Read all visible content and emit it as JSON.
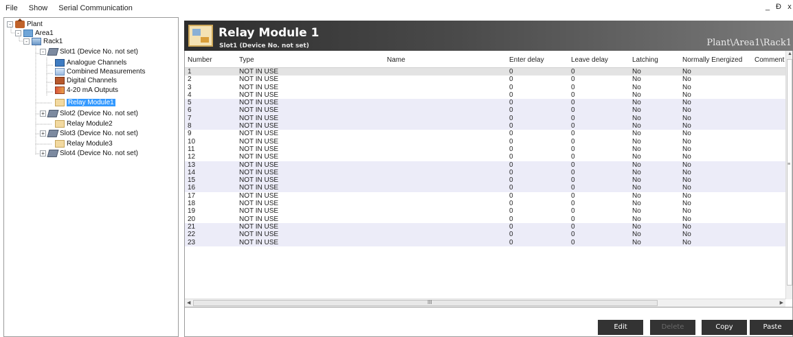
{
  "menu": {
    "items": [
      "File",
      "Show",
      "Serial Communication"
    ]
  },
  "window_controls": {
    "minimize": "_",
    "restore": "Ɖ",
    "close": "x"
  },
  "tree": {
    "nodes": [
      {
        "label": "Plant",
        "icon": "plant-icon",
        "expander": "-"
      },
      {
        "label": "Area1",
        "icon": "area-icon",
        "expander": "-"
      },
      {
        "label": "Rack1",
        "icon": "rack-icon",
        "expander": "-"
      },
      {
        "label": "Slot1 (Device No. not set)",
        "icon": "slot-icon",
        "expander": "-"
      },
      {
        "label": "Analogue Channels",
        "icon": "analogue-channels-icon"
      },
      {
        "label": "Combined Measurements",
        "icon": "combined-measurements-icon"
      },
      {
        "label": "Digital Channels",
        "icon": "digital-channels-icon"
      },
      {
        "label": "4-20 mA Outputs",
        "icon": "outputs-icon"
      },
      {
        "label": "Relay Module1",
        "icon": "relay-module-icon",
        "selected": true
      },
      {
        "label": "Slot2 (Device No. not set)",
        "icon": "slot-icon",
        "expander": "+"
      },
      {
        "label": "Relay Module2",
        "icon": "relay-module-icon"
      },
      {
        "label": "Slot3 (Device No. not set)",
        "icon": "slot-icon",
        "expander": "+"
      },
      {
        "label": "Relay Module3",
        "icon": "relay-module-icon"
      },
      {
        "label": "Slot4 (Device No. not set)",
        "icon": "slot-icon",
        "expander": "+"
      }
    ]
  },
  "header": {
    "title": "Relay Module 1",
    "subtitle": "Slot1 (Device No. not set)",
    "path": "Plant\\Area1\\Rack1"
  },
  "table": {
    "columns": [
      "Number",
      "Type",
      "Name",
      "Enter delay",
      "Leave delay",
      "Latching",
      "Normally Energized",
      "Comment"
    ],
    "rows": [
      [
        "1",
        "NOT IN USE",
        "",
        "0",
        "0",
        "No",
        "No",
        ""
      ],
      [
        "2",
        "NOT IN USE",
        "",
        "0",
        "0",
        "No",
        "No",
        ""
      ],
      [
        "3",
        "NOT IN USE",
        "",
        "0",
        "0",
        "No",
        "No",
        ""
      ],
      [
        "4",
        "NOT IN USE",
        "",
        "0",
        "0",
        "No",
        "No",
        ""
      ],
      [
        "5",
        "NOT IN USE",
        "",
        "0",
        "0",
        "No",
        "No",
        ""
      ],
      [
        "6",
        "NOT IN USE",
        "",
        "0",
        "0",
        "No",
        "No",
        ""
      ],
      [
        "7",
        "NOT IN USE",
        "",
        "0",
        "0",
        "No",
        "No",
        ""
      ],
      [
        "8",
        "NOT IN USE",
        "",
        "0",
        "0",
        "No",
        "No",
        ""
      ],
      [
        "9",
        "NOT IN USE",
        "",
        "0",
        "0",
        "No",
        "No",
        ""
      ],
      [
        "10",
        "NOT IN USE",
        "",
        "0",
        "0",
        "No",
        "No",
        ""
      ],
      [
        "11",
        "NOT IN USE",
        "",
        "0",
        "0",
        "No",
        "No",
        ""
      ],
      [
        "12",
        "NOT IN USE",
        "",
        "0",
        "0",
        "No",
        "No",
        ""
      ],
      [
        "13",
        "NOT IN USE",
        "",
        "0",
        "0",
        "No",
        "No",
        ""
      ],
      [
        "14",
        "NOT IN USE",
        "",
        "0",
        "0",
        "No",
        "No",
        ""
      ],
      [
        "15",
        "NOT IN USE",
        "",
        "0",
        "0",
        "No",
        "No",
        ""
      ],
      [
        "16",
        "NOT IN USE",
        "",
        "0",
        "0",
        "No",
        "No",
        ""
      ],
      [
        "17",
        "NOT IN USE",
        "",
        "0",
        "0",
        "No",
        "No",
        ""
      ],
      [
        "18",
        "NOT IN USE",
        "",
        "0",
        "0",
        "No",
        "No",
        ""
      ],
      [
        "19",
        "NOT IN USE",
        "",
        "0",
        "0",
        "No",
        "No",
        ""
      ],
      [
        "20",
        "NOT IN USE",
        "",
        "0",
        "0",
        "No",
        "No",
        ""
      ],
      [
        "21",
        "NOT IN USE",
        "",
        "0",
        "0",
        "No",
        "No",
        ""
      ],
      [
        "22",
        "NOT IN USE",
        "",
        "0",
        "0",
        "No",
        "No",
        ""
      ],
      [
        "23",
        "NOT IN USE",
        "",
        "0",
        "0",
        "No",
        "No",
        ""
      ]
    ],
    "selected_row": 0,
    "band_groups": [
      [
        4,
        7
      ],
      [
        12,
        15
      ],
      [
        20,
        22
      ]
    ],
    "scroll_grip": "III"
  },
  "buttons": {
    "edit": "Edit",
    "delete": "Delete",
    "copy": "Copy",
    "paste": "Paste"
  },
  "colors": {
    "selection": "#3399ff",
    "band": "#ececf8",
    "button_bg": "#333333"
  }
}
